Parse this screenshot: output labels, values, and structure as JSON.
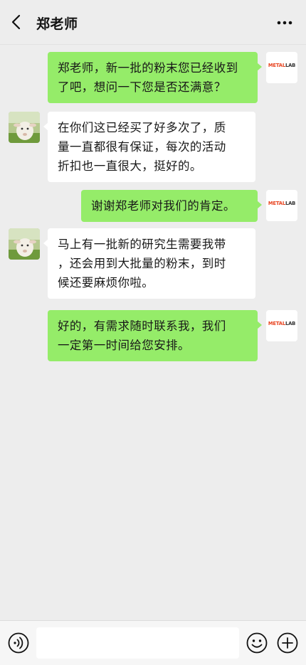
{
  "header": {
    "title": "郑老师",
    "back_icon": "chevron-left-icon",
    "more_icon": "more-dots-icon"
  },
  "logo": {
    "part1": "METAL",
    "part2": "LAB"
  },
  "messages": [
    {
      "sender": "me",
      "lines": [
        "郑老师，新一批的粉末您已经收到",
        "了吧，想问一下您是否还满意？"
      ]
    },
    {
      "sender": "other",
      "lines": [
        "在你们这已经买了好多次了，质",
        "量一直都很有保证，每次的活动",
        "折扣也一直很大，挺好的。"
      ]
    },
    {
      "sender": "me",
      "lines": [
        "谢谢郑老师对我们的肯定。"
      ]
    },
    {
      "sender": "other",
      "lines": [
        "马上有一批新的研究生需要我带",
        "，还会用到大批量的粉末，到时",
        "候还要麻烦你啦。"
      ]
    },
    {
      "sender": "me",
      "lines": [
        "好的，有需求随时联系我，我们",
        "一定第一时间给您安排。"
      ]
    }
  ],
  "input_bar": {
    "voice_icon": "voice-icon",
    "input_value": "",
    "emoji_icon": "emoji-icon",
    "plus_icon": "plus-icon"
  }
}
